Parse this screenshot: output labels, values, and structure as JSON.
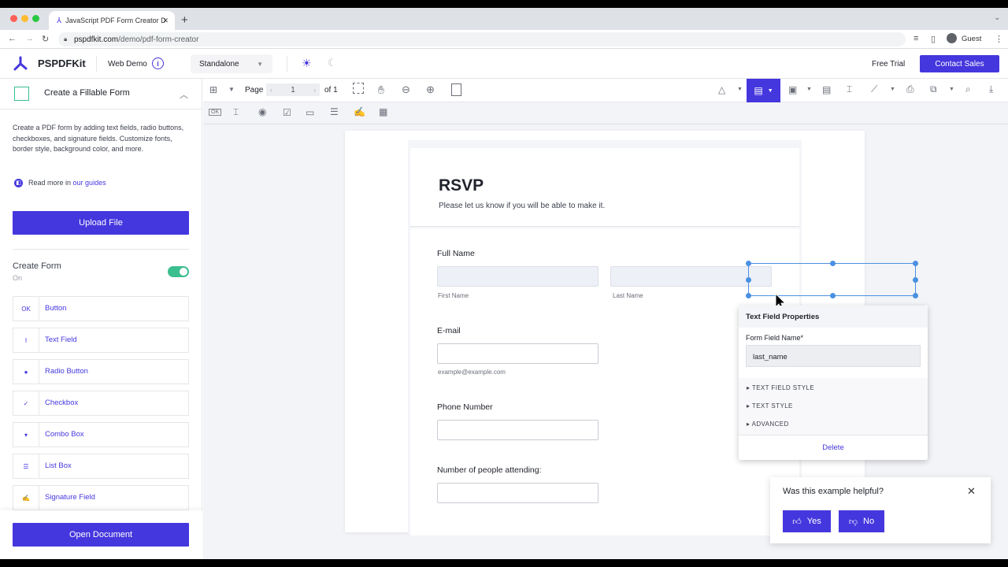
{
  "browser": {
    "tab_title": "JavaScript PDF Form Creator D",
    "new_tab_icon": "+",
    "url_domain": "pspdfkit.com",
    "url_path": "/demo/pdf-form-creator",
    "profile": "Guest"
  },
  "header": {
    "brand": "PSPDFKit",
    "web_demo": "Web Demo",
    "mode": "Standalone",
    "free_trial": "Free Trial",
    "contact_sales": "Contact Sales"
  },
  "sidebar": {
    "title": "Create a Fillable Form",
    "description": "Create a PDF form by adding text fields, radio buttons, checkboxes, and signature fields. Customize fonts, border style, background color, and more.",
    "read_more": "Read more in",
    "guides_link": "our guides",
    "upload_label": "Upload File",
    "create_form_label": "Create Form",
    "create_form_state": "On",
    "fields": [
      {
        "icon": "OK",
        "label": "Button"
      },
      {
        "icon": "I",
        "label": "Text Field"
      },
      {
        "icon": "●",
        "label": "Radio Button"
      },
      {
        "icon": "✓",
        "label": "Checkbox"
      },
      {
        "icon": "▾",
        "label": "Combo Box"
      },
      {
        "icon": "☰",
        "label": "List Box"
      },
      {
        "icon": "✍",
        "label": "Signature Field"
      }
    ],
    "open_document": "Open Document"
  },
  "toolbar": {
    "page_label": "Page",
    "page_value": "1",
    "page_total": "of 1"
  },
  "document": {
    "title": "RSVP",
    "subtitle": "Please let us know if you will be able to make it.",
    "full_name_label": "Full Name",
    "first_name_hint": "First Name",
    "last_name_hint": "Last Name",
    "email_label": "E-mail",
    "email_hint": "example@example.com",
    "phone_label": "Phone Number",
    "attending_label": "Number of people attending:"
  },
  "properties": {
    "header": "Text Field Properties",
    "field_name_label": "Form Field Name*",
    "field_name_value": "last_name",
    "sections": [
      "TEXT FIELD STYLE",
      "TEXT STYLE",
      "ADVANCED"
    ],
    "delete_label": "Delete"
  },
  "feedback": {
    "question": "Was this example helpful?",
    "yes": "Yes",
    "no": "No"
  },
  "colors": {
    "accent": "#4537de",
    "toggle_on": "#3bbf8f",
    "selection": "#4a90e2"
  }
}
